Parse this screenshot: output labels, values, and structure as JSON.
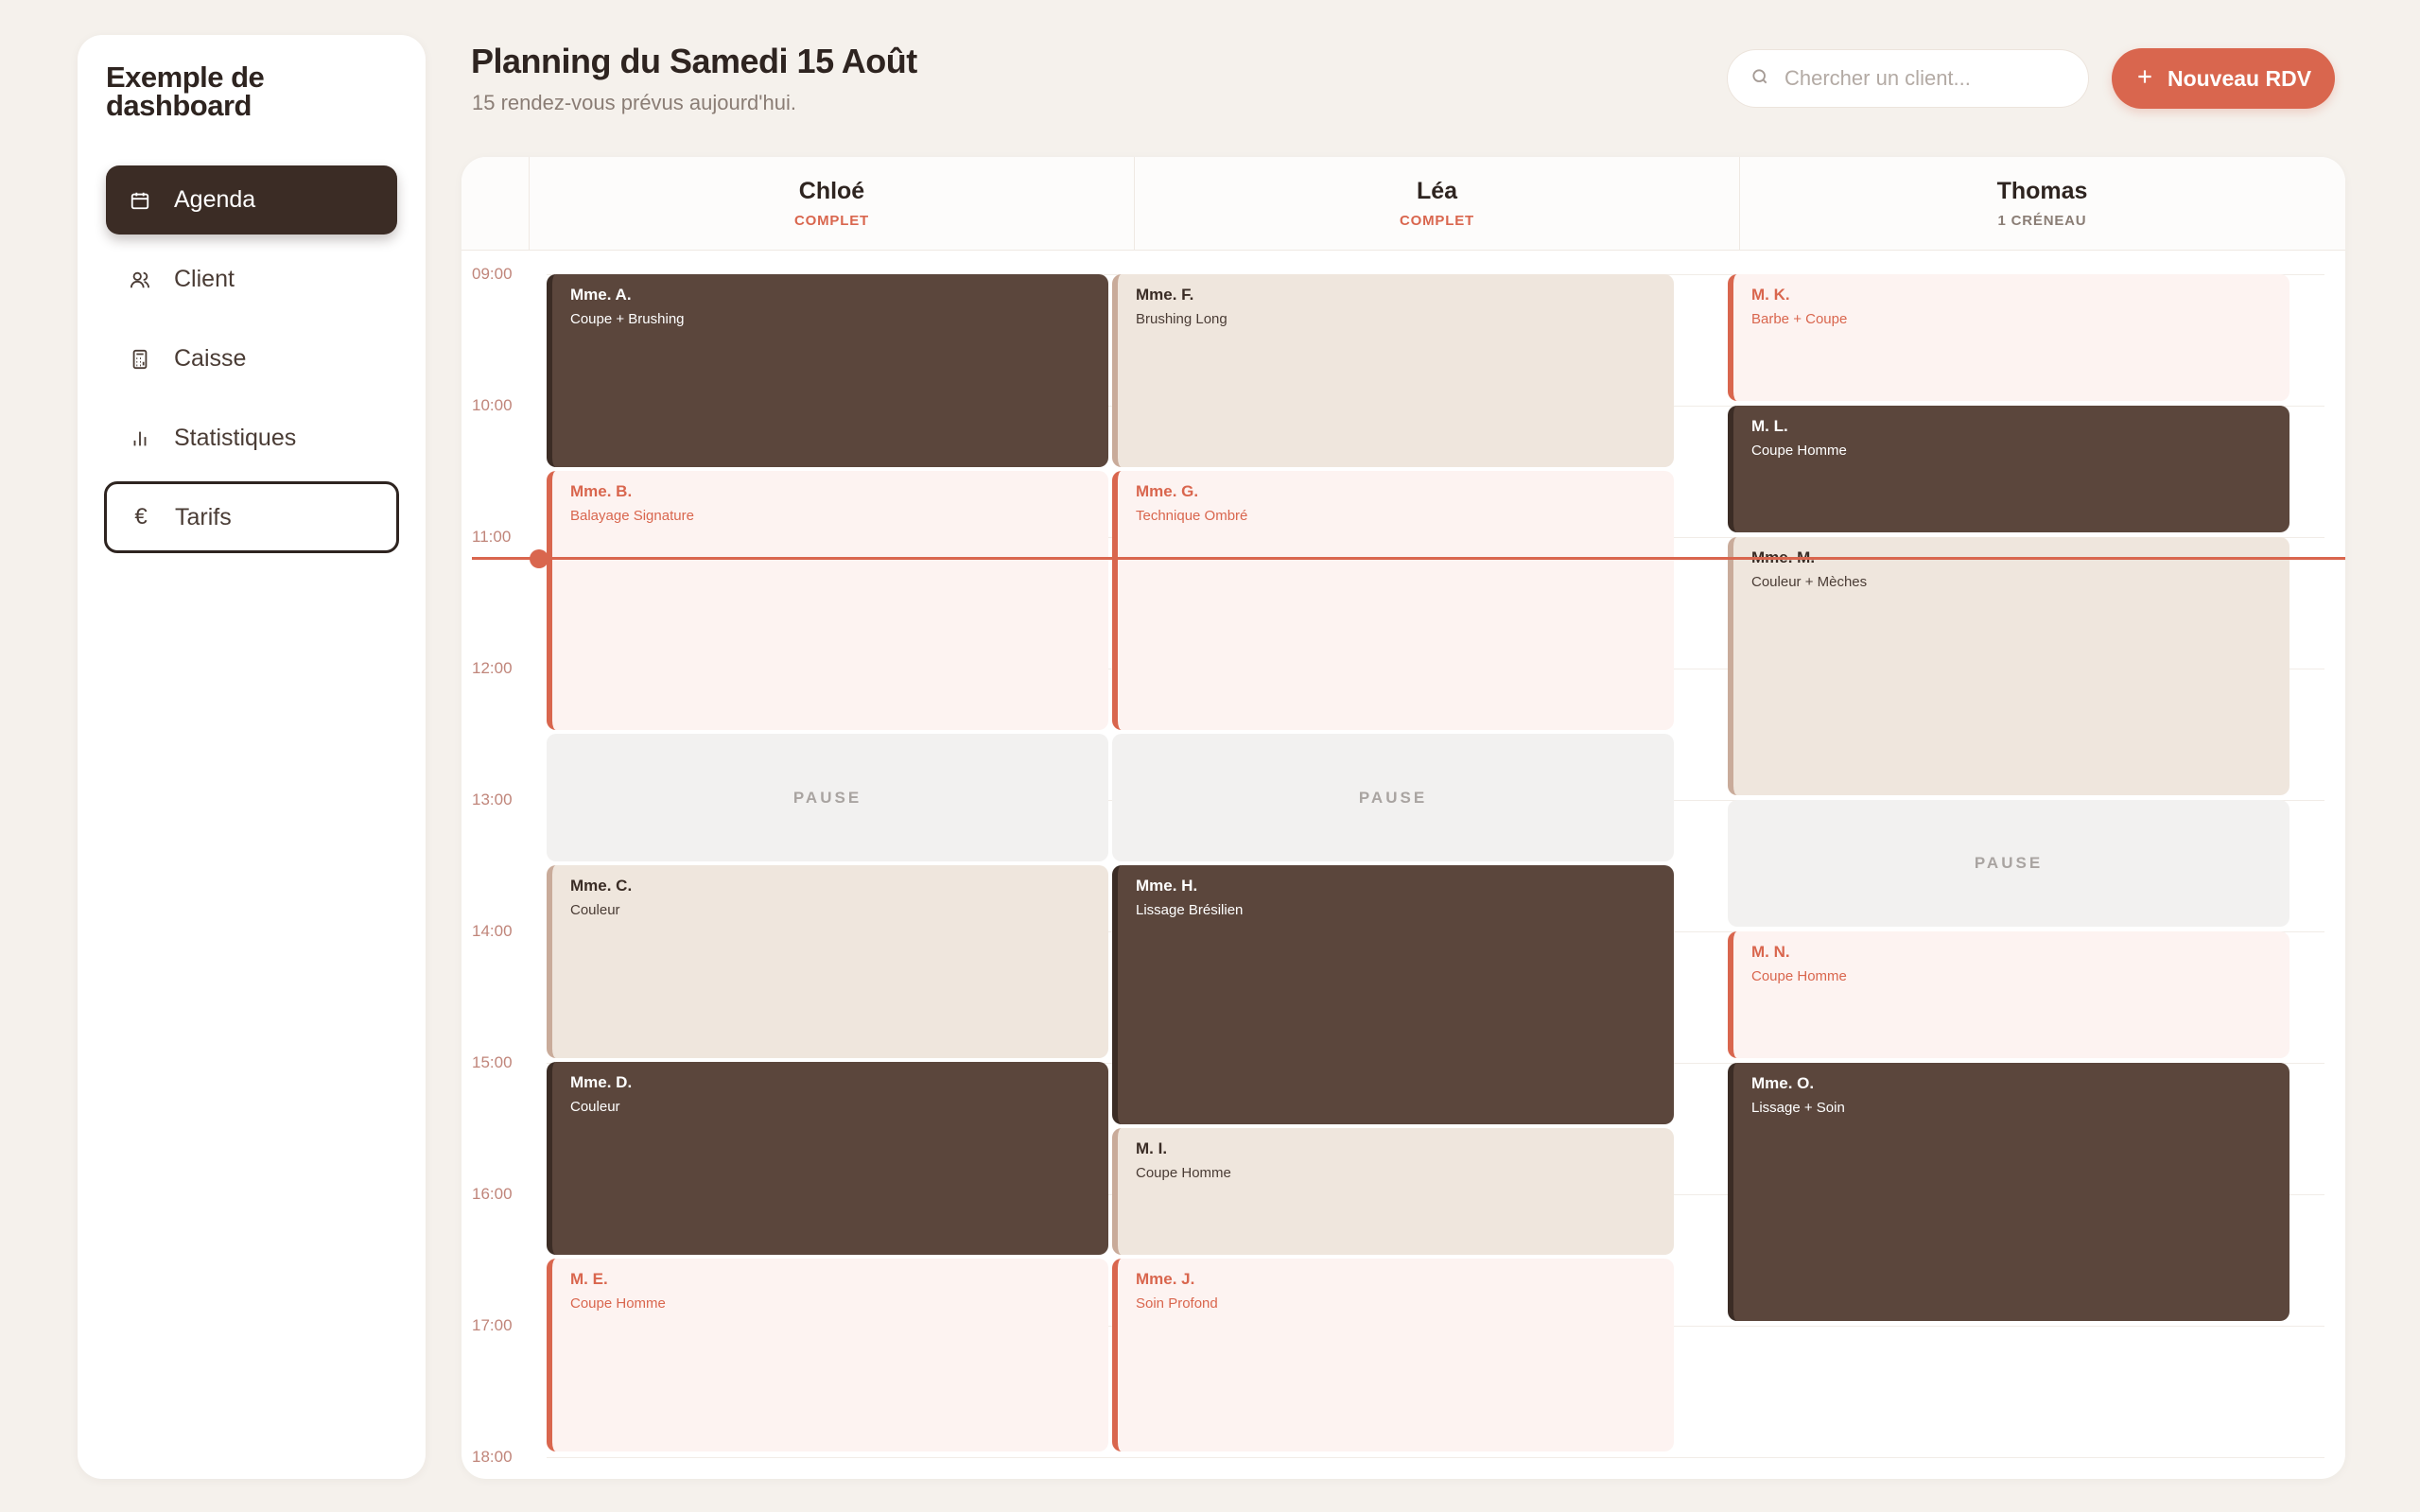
{
  "sidebar": {
    "brand": "Exemple de dashboard",
    "items": [
      {
        "label": "Agenda",
        "icon": "calendar-icon"
      },
      {
        "label": "Client",
        "icon": "users-icon"
      },
      {
        "label": "Caisse",
        "icon": "calculator-icon"
      },
      {
        "label": "Statistiques",
        "icon": "bar-chart-icon"
      },
      {
        "label": "Tarifs",
        "icon": "euro-icon"
      }
    ]
  },
  "header": {
    "title": "Planning du Samedi 15 Août",
    "subtitle": "15 rendez-vous prévus aujourd'hui.",
    "search_placeholder": "Chercher un client...",
    "new_button": "Nouveau RDV"
  },
  "calendar": {
    "columns": [
      {
        "name": "Chloé",
        "status": "COMPLET"
      },
      {
        "name": "Léa",
        "status": "COMPLET"
      },
      {
        "name": "Thomas",
        "status": "1 CRÉNEAU"
      }
    ],
    "hours": [
      "09:00",
      "10:00",
      "11:00",
      "12:00",
      "13:00",
      "14:00",
      "15:00",
      "16:00",
      "17:00",
      "18:00"
    ],
    "pause_label": "PAUSE",
    "appointments": {
      "a": {
        "client": "Mme. A.",
        "service": "Coupe + Brushing"
      },
      "b": {
        "client": "Mme. B.",
        "service": "Balayage Signature"
      },
      "c": {
        "client": "Mme. C.",
        "service": "Couleur"
      },
      "d": {
        "client": "Mme. D.",
        "service": "Couleur"
      },
      "e": {
        "client": "M. E.",
        "service": "Coupe Homme"
      },
      "f": {
        "client": "Mme. F.",
        "service": "Brushing Long"
      },
      "g": {
        "client": "Mme. G.",
        "service": "Technique Ombré"
      },
      "h": {
        "client": "Mme. H.",
        "service": "Lissage Brésilien"
      },
      "i": {
        "client": "M. I.",
        "service": "Coupe Homme"
      },
      "j": {
        "client": "Mme. J.",
        "service": "Soin Profond"
      },
      "k": {
        "client": "M. K.",
        "service": "Barbe + Coupe"
      },
      "l": {
        "client": "M. L.",
        "service": "Coupe Homme"
      },
      "m": {
        "client": "Mme. M.",
        "service": "Couleur + Mèches"
      },
      "n": {
        "client": "M. N.",
        "service": "Coupe Homme"
      },
      "o": {
        "client": "Mme. O.",
        "service": "Lissage + Soin"
      }
    }
  },
  "colors": {
    "accent": "#d9664e",
    "dark": "#3b2c25",
    "appointment_dark": "#5b463c",
    "appointment_beige": "#efe6dd",
    "appointment_pink": "#fdf3f1",
    "background": "#f5f1ec"
  }
}
